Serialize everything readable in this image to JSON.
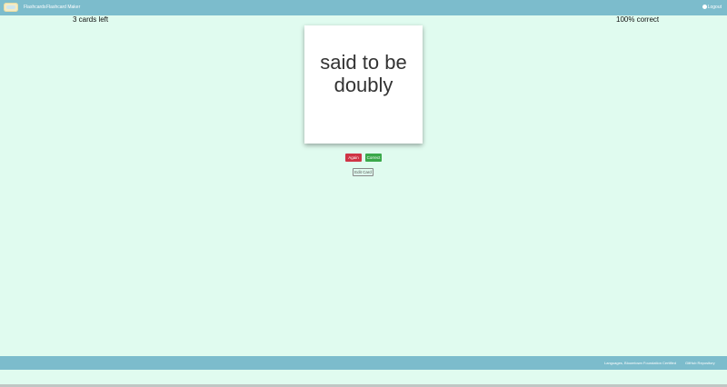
{
  "navbar": {
    "logo_icon": "flashcard-logo-icon",
    "links": [
      {
        "label": "Flashcards"
      },
      {
        "label": "Flashcard Maker"
      }
    ],
    "logout_label": "Logout",
    "logout_icon": "gear-icon",
    "color": "#7cbccc"
  },
  "session": {
    "cards_left": "3 cards left",
    "percent_correct": "100% correct"
  },
  "card": {
    "text": "said to be doubly"
  },
  "buttons": {
    "again": "Again",
    "correct": "Correct",
    "edit": "Edit Card"
  },
  "footer": {
    "left_text": "Languages, Bloomtown Foundation Certified",
    "right_text": "GitHub Repository"
  },
  "colors": {
    "background": "#e0fbef",
    "again": "#cf3445",
    "correct": "#3aa84a"
  }
}
